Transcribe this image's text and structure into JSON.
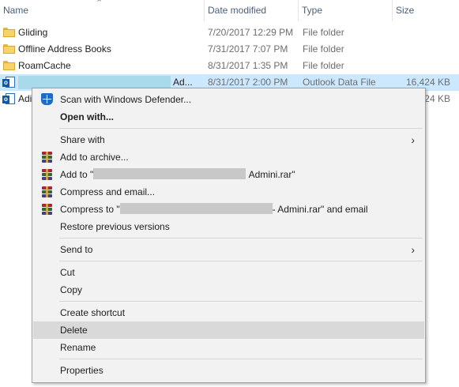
{
  "columns": {
    "name": "Name",
    "date": "Date modified",
    "type": "Type",
    "size": "Size"
  },
  "files": [
    {
      "name": "Gliding",
      "date": "7/20/2017 12:29 PM",
      "type": "File folder",
      "size": ""
    },
    {
      "name": "Offline Address Books",
      "date": "7/31/2017 7:07 PM",
      "type": "File folder",
      "size": ""
    },
    {
      "name": "RoamCache",
      "date": "8/31/2017 1:35 PM",
      "type": "File folder",
      "size": ""
    },
    {
      "name": "Ad...",
      "date": "8/31/2017 2:00 PM",
      "type": "Outlook Data File",
      "size": "16,424 KB"
    },
    {
      "name": "Adi",
      "date": "",
      "type": "",
      "size": "24 KB"
    }
  ],
  "menu": {
    "scan": "Scan with Windows Defender...",
    "open_with": "Open with...",
    "share_with": "Share with",
    "add_archive": "Add to archive...",
    "add_to_prefix": "Add to \"",
    "add_to_suffix": "Admini.rar\"",
    "compress_email": "Compress and email...",
    "compress_to_prefix": "Compress to \"",
    "compress_to_suffix": "- Admini.rar\" and email",
    "restore": "Restore previous versions",
    "send_to": "Send to",
    "cut": "Cut",
    "copy": "Copy",
    "create_shortcut": "Create shortcut",
    "delete": "Delete",
    "rename": "Rename",
    "properties": "Properties"
  },
  "colors": {
    "selection": "#cce8ff",
    "menu_bg": "#f2f2f2",
    "menu_highlight": "#d9d9d9"
  }
}
